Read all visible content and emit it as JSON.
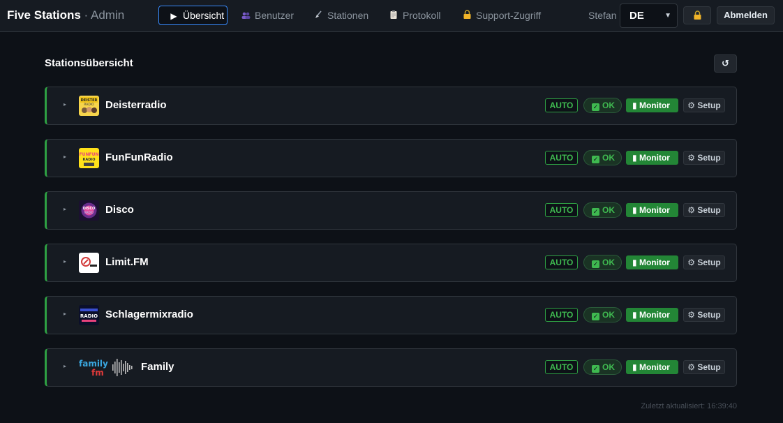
{
  "header": {
    "brand": "Five Stations",
    "brand_sub": "· Admin",
    "nav": [
      {
        "label": "Übersicht",
        "icon": "play-icon"
      },
      {
        "label": "Benutzer",
        "icon": "users-icon"
      },
      {
        "label": "Stationen",
        "icon": "broom-icon"
      },
      {
        "label": "Protokoll",
        "icon": "clipboard-icon"
      },
      {
        "label": "Support-Zugriff",
        "icon": "lock-icon"
      }
    ],
    "user": "Stefan",
    "language": "DE",
    "lock_icon": "lock-icon",
    "logout": "Abmelden"
  },
  "main": {
    "title": "Stationsübersicht",
    "refresh_icon": "refresh-icon",
    "stations": [
      {
        "name": "Deisterradio",
        "logo": "deisterradio-logo",
        "auto": "AUTO",
        "status": "OK",
        "monitor": "Monitor",
        "setup": "Setup"
      },
      {
        "name": "FunFunRadio",
        "logo": "funfunradio-logo",
        "auto": "AUTO",
        "status": "OK",
        "monitor": "Monitor",
        "setup": "Setup"
      },
      {
        "name": "Disco",
        "logo": "disco-logo",
        "auto": "AUTO",
        "status": "OK",
        "monitor": "Monitor",
        "setup": "Setup"
      },
      {
        "name": "Limit.FM",
        "logo": "limitfm-logo",
        "auto": "AUTO",
        "status": "OK",
        "monitor": "Monitor",
        "setup": "Setup"
      },
      {
        "name": "Schlagermixradio",
        "logo": "schlagermixradio-logo",
        "auto": "AUTO",
        "status": "OK",
        "monitor": "Monitor",
        "setup": "Setup"
      },
      {
        "name": "Family",
        "logo": "familyfm-logo",
        "auto": "AUTO",
        "status": "OK",
        "monitor": "Monitor",
        "setup": "Setup"
      }
    ],
    "last_updated": "Zuletzt aktualisiert: 16:39:40"
  },
  "colors": {
    "background": "#0d1117",
    "panel": "#161b22",
    "accent_green": "#2ea043",
    "accent_blue": "#388bfd"
  }
}
